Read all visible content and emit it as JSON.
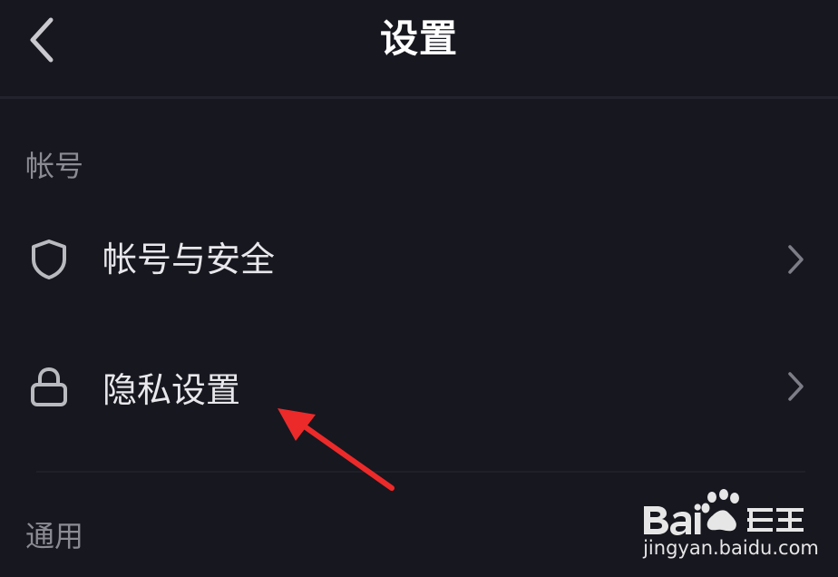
{
  "header": {
    "title": "设置",
    "back_icon": "chevron-left-icon"
  },
  "sections": [
    {
      "label": "帐号",
      "items": [
        {
          "label": "帐号与安全",
          "icon": "shield-icon",
          "trailing_icon": "chevron-right-icon"
        },
        {
          "label": "隐私设置",
          "icon": "lock-icon",
          "trailing_icon": "chevron-right-icon"
        }
      ]
    },
    {
      "label": "通用",
      "items": []
    }
  ],
  "annotation": {
    "type": "red-arrow",
    "color": "#ec2a2a",
    "points_to": "隐私设置"
  },
  "watermark": {
    "brand": "Baidu经验",
    "url": "jingyan.baidu.com"
  },
  "colors": {
    "background": "#17171f",
    "text_primary": "#ffffff",
    "text_secondary": "#8a8b93",
    "icon": "#b9b9c0",
    "arrow": "#ec2a2a"
  }
}
